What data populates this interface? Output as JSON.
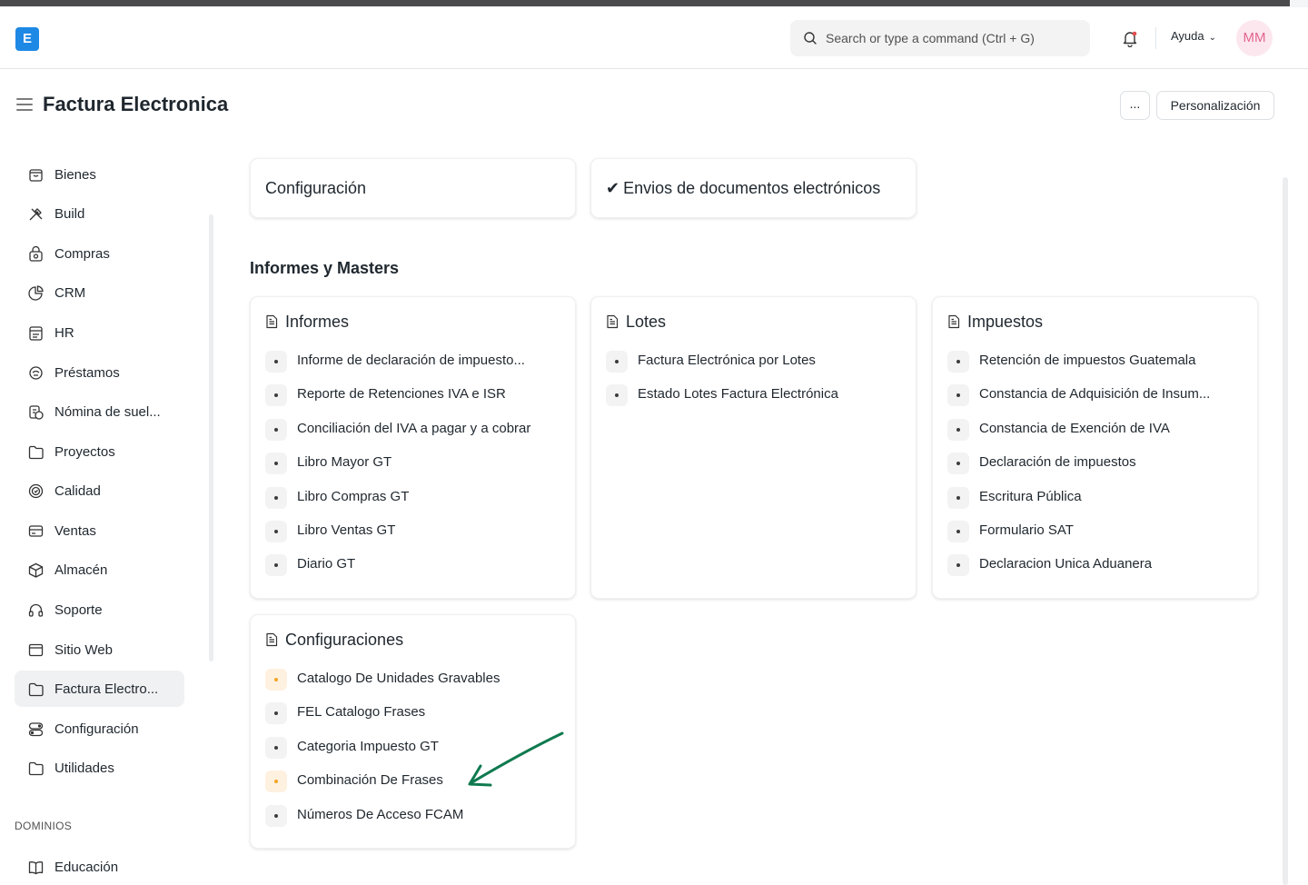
{
  "app": {
    "logo_letter": "E",
    "search_placeholder": "Search or type a command (Ctrl + G)",
    "help_label": "Ayuda",
    "avatar_initials": "MM"
  },
  "page": {
    "title": "Factura Electronica",
    "more_label": "...",
    "customize_label": "Personalización"
  },
  "sidebar": {
    "items": [
      {
        "label": "Bienes",
        "icon": "box-icon"
      },
      {
        "label": "Build",
        "icon": "tools-icon"
      },
      {
        "label": "Compras",
        "icon": "basket-icon"
      },
      {
        "label": "CRM",
        "icon": "pie-chart-icon"
      },
      {
        "label": "HR",
        "icon": "users-icon"
      },
      {
        "label": "Préstamos",
        "icon": "loan-icon"
      },
      {
        "label": "Nómina de suel...",
        "icon": "payroll-icon"
      },
      {
        "label": "Proyectos",
        "icon": "folder-icon"
      },
      {
        "label": "Calidad",
        "icon": "quality-icon"
      },
      {
        "label": "Ventas",
        "icon": "card-icon"
      },
      {
        "label": "Almacén",
        "icon": "package-icon"
      },
      {
        "label": "Soporte",
        "icon": "headset-icon"
      },
      {
        "label": "Sitio Web",
        "icon": "browser-icon"
      },
      {
        "label": "Factura Electro...",
        "icon": "folder-icon",
        "active": true
      },
      {
        "label": "Configuración",
        "icon": "toggle-icon"
      },
      {
        "label": "Utilidades",
        "icon": "folder-icon"
      }
    ],
    "section_label": "DOMINIOS",
    "domain_items": [
      {
        "label": "Educación",
        "icon": "book-icon"
      }
    ]
  },
  "shortcuts": [
    {
      "label": "Configuración"
    },
    {
      "label": "Envios de documentos electrónicos",
      "checked": true
    }
  ],
  "section_title": "Informes y Masters",
  "cards": [
    {
      "title": "Informes",
      "links": [
        {
          "label": "Informe de declaración de impuesto..."
        },
        {
          "label": "Reporte de Retenciones IVA e ISR"
        },
        {
          "label": "Conciliación del IVA a pagar y a cobrar"
        },
        {
          "label": "Libro Mayor GT"
        },
        {
          "label": "Libro Compras GT"
        },
        {
          "label": "Libro Ventas GT"
        },
        {
          "label": "Diario GT"
        }
      ]
    },
    {
      "title": "Lotes",
      "links": [
        {
          "label": "Factura Electrónica por Lotes"
        },
        {
          "label": "Estado Lotes Factura Electrónica"
        }
      ]
    },
    {
      "title": "Impuestos",
      "links": [
        {
          "label": "Retención de impuestos Guatemala"
        },
        {
          "label": "Constancia de Adquisición de Insum..."
        },
        {
          "label": "Constancia de Exención de IVA"
        },
        {
          "label": "Declaración de impuestos"
        },
        {
          "label": "Escritura Pública"
        },
        {
          "label": "Formulario SAT"
        },
        {
          "label": "Declaracion Unica Aduanera"
        }
      ]
    },
    {
      "title": "Configuraciones",
      "links": [
        {
          "label": "Catalogo De Unidades Gravables",
          "warn": true
        },
        {
          "label": "FEL Catalogo Frases"
        },
        {
          "label": "Categoria Impuesto GT"
        },
        {
          "label": "Combinación De Frases",
          "warn": true
        },
        {
          "label": "Números De Acceso FCAM"
        }
      ]
    }
  ],
  "colors": {
    "accent": "#1e88e5",
    "arrow": "#0f7a4f",
    "warn_dot": "#f5a524",
    "avatar_bg": "#fce7ef",
    "avatar_text": "#e2658c"
  }
}
